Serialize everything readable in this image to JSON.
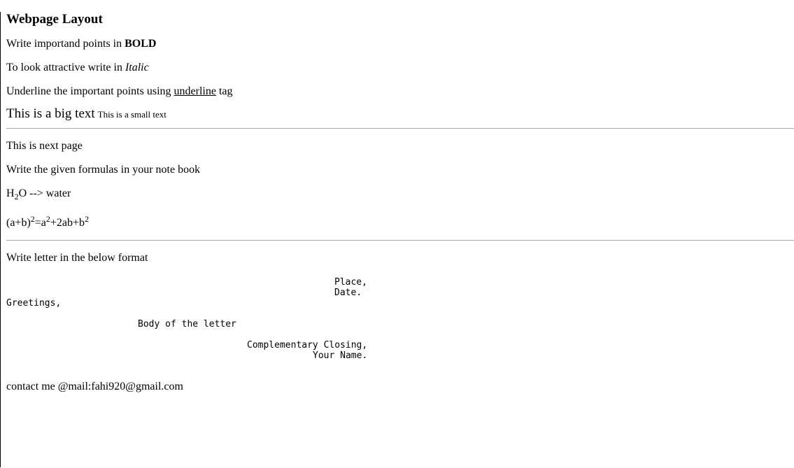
{
  "heading": "Webpage Layout",
  "line_bold": {
    "prefix": "Write importand points in ",
    "bold": "BOLD"
  },
  "line_italic": {
    "prefix": "To look attractive write in ",
    "italic": "Italic"
  },
  "line_underline": {
    "prefix": "Underline the important points using ",
    "underlined": "underline",
    "suffix": " tag"
  },
  "big_text": "This is a big text",
  "small_text": "This is a small text",
  "section2": {
    "title": "This is next page",
    "instruction": "Write the given formulas in your note book",
    "formula1": {
      "h": "H",
      "sub": "2",
      "o": "O",
      "rest": " --> water"
    },
    "formula2": {
      "lhs": "(a+b)",
      "exp1": "2",
      "eq": "=a",
      "exp2": "2",
      "mid": "+2ab+b",
      "exp3": "2"
    }
  },
  "section3": {
    "instruction": "Write letter in the below format",
    "place": "Place,",
    "date": "Date.",
    "greetings": "Greetings,",
    "body": "Body of the letter",
    "closing": "Complementary Closing,",
    "name": "Your Name."
  },
  "contact": "contact me @mail:fahi920@gmail.com"
}
